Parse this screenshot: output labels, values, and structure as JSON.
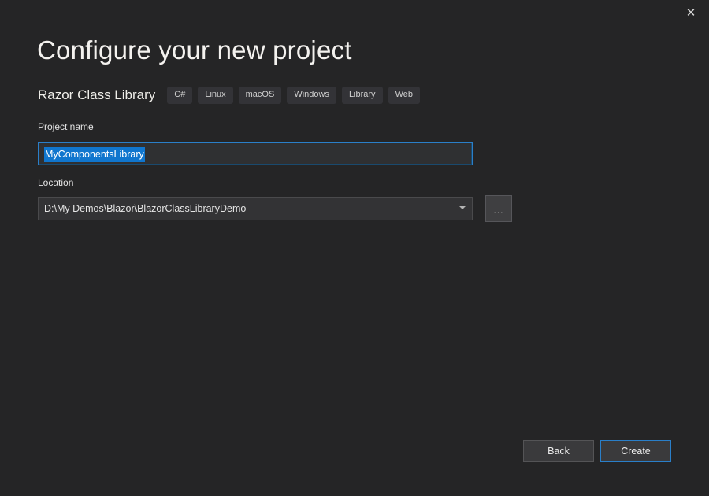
{
  "window": {
    "restore_label": "Restore",
    "close_label": "Close"
  },
  "header": {
    "title": "Configure your new project",
    "template_name": "Razor Class Library",
    "tags": [
      "C#",
      "Linux",
      "macOS",
      "Windows",
      "Library",
      "Web"
    ]
  },
  "form": {
    "project_name": {
      "label": "Project name",
      "value": "MyComponentsLibrary",
      "placeholder": "",
      "selected": true
    },
    "location": {
      "label": "Location",
      "value": "D:\\My Demos\\Blazor\\BlazorClassLibraryDemo",
      "placeholder": "",
      "browse_label": "..."
    }
  },
  "footer": {
    "back_label": "Back",
    "create_label": "Create"
  },
  "colors": {
    "background": "#252526",
    "accent": "#0078d4",
    "selection": "#1076ce",
    "tag_background": "#333337",
    "button_background": "#3a3a3c"
  }
}
